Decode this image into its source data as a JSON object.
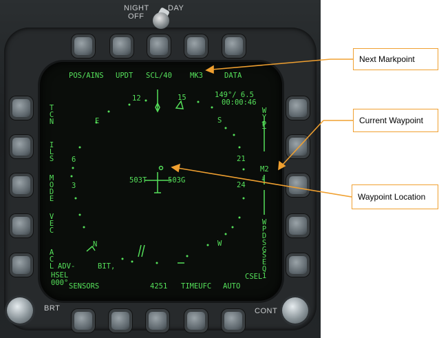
{
  "panel": {
    "toggle_label_night": "NIGHT",
    "toggle_label_day": "DAY",
    "toggle_label_off": "OFF",
    "brt_label": "BRT",
    "cont_label": "CONT"
  },
  "ddi": {
    "top_options": [
      "POS/AINS",
      "UPDT",
      "SCL/40",
      "MK3",
      "DATA"
    ],
    "bottom_options": [
      "SENSORS",
      "4251",
      "TIMEUFC",
      "AUTO"
    ],
    "left_options": [
      "TCN",
      "ILS",
      "MODE",
      "VEC",
      "ACL"
    ],
    "right_options": [
      "WYPT",
      "M2",
      "WPDSG",
      "SEQ1"
    ],
    "right_arrow_up": "↑",
    "right_arrow_down": "↓",
    "bearing_range": "149°/  6.5",
    "time_to_go": "00:00:46",
    "compass": {
      "n12": "12",
      "n15": "15",
      "E": "E",
      "S": "S",
      "n6": "6",
      "n21": "21",
      "n3": "3",
      "n24": "24",
      "W": "W",
      "N": "N"
    },
    "wind_left": "503T",
    "wind_right": "503G",
    "adv_label": "ADV-",
    "bit_label": "BIT,",
    "hsel_label": "HSEL",
    "hsel_value": "000°",
    "csel_label": "CSEL"
  },
  "callouts": {
    "next_markpoint": "Next Markpoint",
    "current_waypoint": "Current Waypoint",
    "waypoint_location": "Waypoint Location"
  },
  "colors": {
    "symbology": "#55e05a",
    "callout_line": "#f0a030"
  }
}
